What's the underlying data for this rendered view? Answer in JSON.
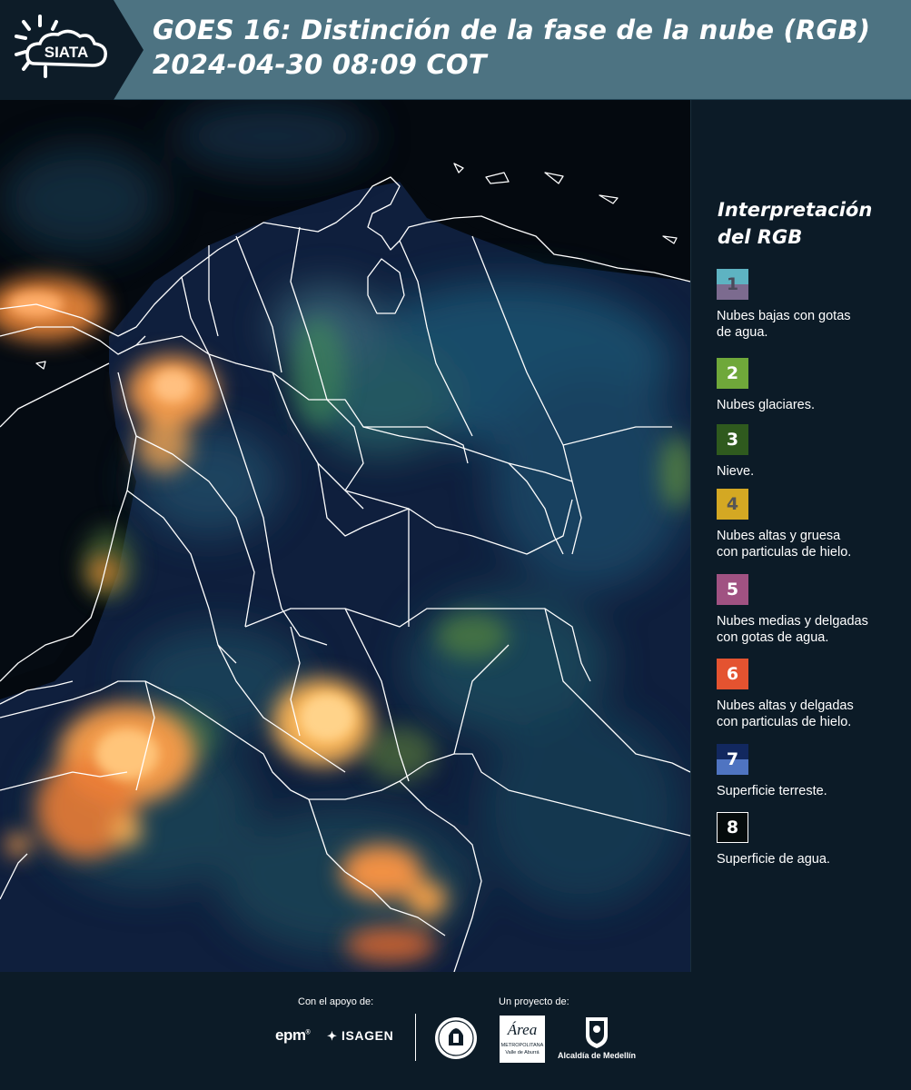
{
  "header": {
    "logo_text": "SIATA",
    "title_line1": "GOES 16: Distinción de la fase de la nube (RGB)",
    "title_line2": " 2024-04-30 08:09 COT",
    "background_color": "#4d7382"
  },
  "map": {
    "background_color": "#050b12",
    "border_color": "#ffffff",
    "land_color": "#0f1f3d",
    "water_color": "#04090f"
  },
  "legend": {
    "title_line1": "Interpretación",
    "title_line2": "del RGB",
    "items": [
      {
        "number": "1",
        "colors": [
          "#5eb3c2",
          "#7c6b8f"
        ],
        "number_color": "#4a4a5a",
        "description_line1": "Nubes bajas con gotas",
        "description_line2": "de agua."
      },
      {
        "number": "2",
        "colors": [
          "#6fa83a"
        ],
        "number_color": "#ffffff",
        "description_line1": "Nubes glaciares.",
        "description_line2": ""
      },
      {
        "number": "3",
        "colors": [
          "#2f5a1e"
        ],
        "number_color": "#ffffff",
        "description_line1": "Nieve.",
        "description_line2": ""
      },
      {
        "number": "4",
        "colors": [
          "#d4a823"
        ],
        "number_color": "#555555",
        "description_line1": "Nubes altas y gruesa",
        "description_line2": "con particulas de hielo."
      },
      {
        "number": "5",
        "colors": [
          "#a05282"
        ],
        "number_color": "#ffffff",
        "description_line1": "Nubes medias y delgadas",
        "description_line2": "con gotas de agua."
      },
      {
        "number": "6",
        "colors": [
          "#e45330"
        ],
        "number_color": "#ffffff",
        "description_line1": "Nubes altas y delgadas",
        "description_line2": "con particulas de hielo."
      },
      {
        "number": "7",
        "colors": [
          "#12285f",
          "#4f74c1"
        ],
        "number_color": "#ffffff",
        "description_line1": "Superficie terreste.",
        "description_line2": ""
      },
      {
        "number": "8",
        "colors": [
          "#050b0c"
        ],
        "number_color": "#ffffff",
        "description_line1": "Superficie de agua.",
        "description_line2": ""
      }
    ]
  },
  "footer": {
    "support_label": "Con el apoyo de:",
    "project_label": "Un proyecto de:",
    "sponsors": [
      "epm",
      "ISAGEN"
    ],
    "partners": [
      "Área Metropolitana Valle de Aburrá",
      "Alcaldía de Medellín"
    ],
    "area_logo_text": "Área",
    "area_logo_sub1": "METROPOLITANA",
    "area_logo_sub2": "Valle de Aburrá",
    "alcaldia_text": "Alcaldía de Medellín"
  }
}
